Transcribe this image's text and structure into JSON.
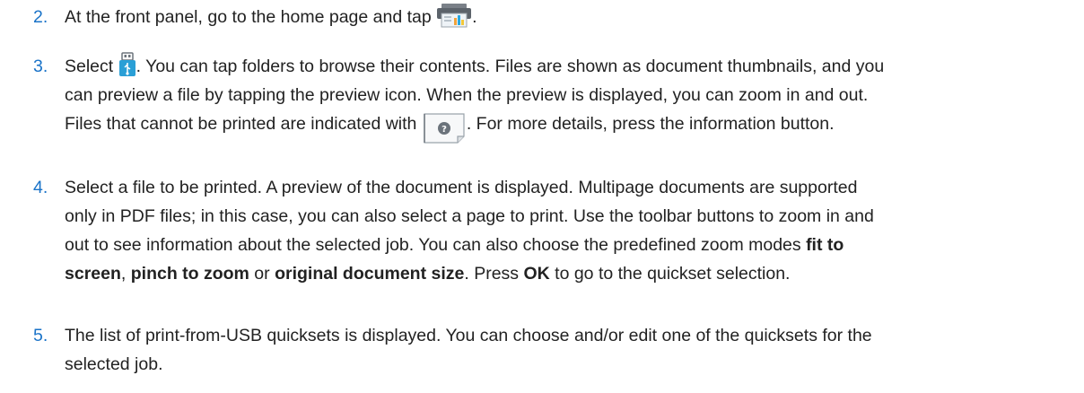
{
  "steps": [
    {
      "number": "2.",
      "line1_pre": "At the front panel, go to the home page and tap ",
      "line1_icon": "printer-icon",
      "line1_post": "."
    },
    {
      "number": "3.",
      "line1_pre": "Select ",
      "line1_icon": "usb-drive-icon",
      "line1_post": ". You can tap folders to browse their contents. Files are shown as document thumbnails, and you",
      "line2": "can preview a file by tapping the preview icon. When the preview is displayed, you can zoom in and out.",
      "line3_pre": "Files that cannot be printed are indicated with ",
      "line3_icon": "unprintable-file-icon",
      "line3_post": ". For more details, press the information button."
    },
    {
      "number": "4.",
      "line1": "Select a file to be printed. A preview of the document is displayed. Multipage documents are supported",
      "line2": "only in PDF files; in this case, you can also select a page to print. Use the toolbar buttons to zoom in and",
      "line3_pre": "out to see information about the selected job. You can also choose the predefined zoom modes ",
      "line3_bold": "fit to",
      "line4_bold1": "screen",
      "line4_mid1": ", ",
      "line4_bold2": "pinch to zoom",
      "line4_mid2": " or ",
      "line4_bold3": "original document size",
      "line4_mid3": ". Press ",
      "line4_bold4": "OK",
      "line4_post": " to go to the quickset selection."
    },
    {
      "number": "5.",
      "line1": "The list of print-from-USB quicksets is displayed. You can choose and/or edit one of the quicksets for the",
      "line2": "selected job."
    }
  ],
  "colors": {
    "step_number": "#1a73c8",
    "text": "#222222",
    "icon_blue": "#29a8e0"
  }
}
